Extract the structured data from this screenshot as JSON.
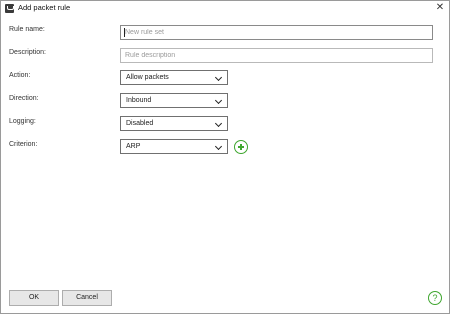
{
  "window": {
    "title": "Add packet rule",
    "close_glyph": "✕",
    "icon": "app-shield-icon"
  },
  "form": {
    "rule_name": {
      "label": "Rule name:",
      "value": "",
      "placeholder": "New rule set"
    },
    "description": {
      "label": "Description:",
      "value": "",
      "placeholder": "Rule description"
    },
    "action": {
      "label": "Action:",
      "selected": "Allow packets"
    },
    "direction": {
      "label": "Direction:",
      "selected": "Inbound"
    },
    "logging": {
      "label": "Logging:",
      "selected": "Disabled"
    },
    "criterion": {
      "label": "Criterion:",
      "selected": "ARP",
      "add_icon": "plus-circle-icon"
    }
  },
  "footer": {
    "ok_label": "OK",
    "cancel_label": "Cancel",
    "help_glyph": "?"
  },
  "colors": {
    "accent": "#3fa62f",
    "border": "#707070"
  }
}
